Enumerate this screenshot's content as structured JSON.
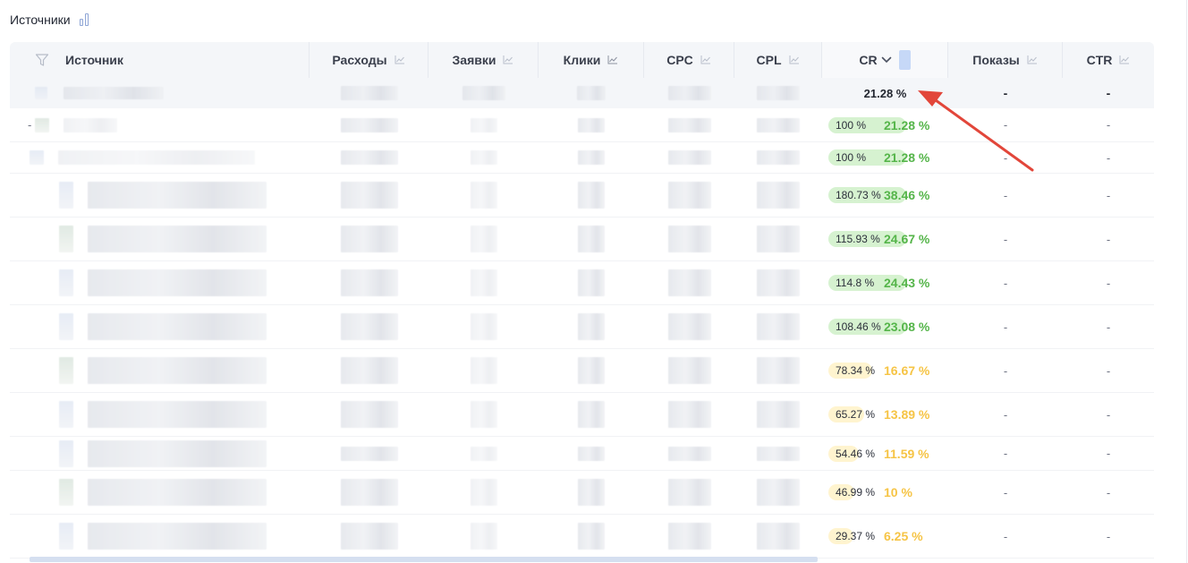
{
  "header": {
    "title": "Источники",
    "view_icon": "bar-chart-icon"
  },
  "columns": [
    {
      "key": "source",
      "label": "Источник",
      "icon": "filter-icon"
    },
    {
      "key": "spend",
      "label": "Расходы",
      "icon": "trend-icon"
    },
    {
      "key": "leads",
      "label": "Заявки",
      "icon": "trend-icon"
    },
    {
      "key": "clicks",
      "label": "Клики",
      "icon": "trend-icon"
    },
    {
      "key": "cpc",
      "label": "CPC",
      "icon": "trend-icon"
    },
    {
      "key": "cpl",
      "label": "CPL",
      "icon": "trend-icon"
    },
    {
      "key": "cr",
      "label": "CR",
      "icon": "chevron-down-icon",
      "sorted": "desc"
    },
    {
      "key": "impressions",
      "label": "Показы",
      "icon": "trend-icon"
    },
    {
      "key": "ctr",
      "label": "CTR",
      "icon": "trend-icon"
    }
  ],
  "totals": {
    "cr": "21.28 %",
    "impressions": "-",
    "ctr": "-"
  },
  "rows": [
    {
      "level": 0,
      "collapse": "-",
      "cr_share": "100 %",
      "cr": "21.28 %",
      "share_value": 100,
      "tone": "green",
      "impressions": "-",
      "ctr": "-"
    },
    {
      "level": 1,
      "collapse": "",
      "cr_share": "100 %",
      "cr": "21.28 %",
      "share_value": 100,
      "tone": "green",
      "impressions": "-",
      "ctr": "-"
    },
    {
      "level": 2,
      "collapse": "",
      "cr_share": "180.73 %",
      "cr": "38.46 %",
      "share_value": 180.73,
      "tone": "green",
      "impressions": "-",
      "ctr": "-"
    },
    {
      "level": 2,
      "collapse": "",
      "cr_share": "115.93 %",
      "cr": "24.67 %",
      "share_value": 115.93,
      "tone": "green",
      "impressions": "-",
      "ctr": "-"
    },
    {
      "level": 2,
      "collapse": "",
      "cr_share": "114.8 %",
      "cr": "24.43 %",
      "share_value": 114.8,
      "tone": "green",
      "impressions": "-",
      "ctr": "-"
    },
    {
      "level": 2,
      "collapse": "",
      "cr_share": "108.46 %",
      "cr": "23.08 %",
      "share_value": 108.46,
      "tone": "green",
      "impressions": "-",
      "ctr": "-"
    },
    {
      "level": 2,
      "collapse": "",
      "cr_share": "78.34 %",
      "cr": "16.67 %",
      "share_value": 78.34,
      "tone": "yellow",
      "impressions": "-",
      "ctr": "-"
    },
    {
      "level": 2,
      "collapse": "",
      "cr_share": "65.27 %",
      "cr": "13.89 %",
      "share_value": 65.27,
      "tone": "yellow",
      "impressions": "-",
      "ctr": "-"
    },
    {
      "level": 2,
      "collapse": "",
      "cr_share": "54.46 %",
      "cr": "11.59 %",
      "share_value": 54.46,
      "tone": "yellow",
      "impressions": "-",
      "ctr": "-"
    },
    {
      "level": 2,
      "collapse": "",
      "cr_share": "46.99 %",
      "cr": "10 %",
      "share_value": 46.99,
      "tone": "yellow",
      "impressions": "-",
      "ctr": "-"
    },
    {
      "level": 2,
      "collapse": "",
      "cr_share": "29.37 %",
      "cr": "6.25 %",
      "share_value": 29.37,
      "tone": "yellow",
      "impressions": "-",
      "ctr": "-"
    }
  ],
  "colors": {
    "accent": "#e2463a",
    "good": "#55b54a",
    "warn": "#f6c445",
    "header_bg": "#f4f6f9"
  }
}
